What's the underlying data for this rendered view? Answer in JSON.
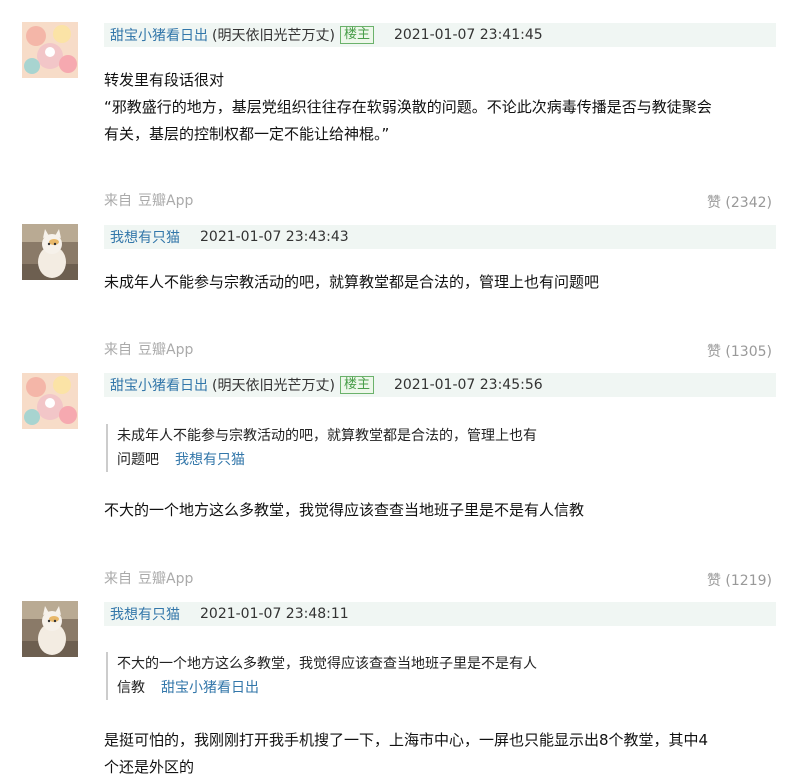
{
  "comments": [
    {
      "username": "甜宝小猪看日出",
      "signature": "(明天依旧光芒万丈)",
      "badge": "楼主",
      "time": "2021-01-07 23:41:45",
      "text_lines": [
        "转发里有段话很对",
        "“邪教盛行的地方，基层党组织往往存在软弱涣散的问题。不论此次病毒传播是否与教徒聚会",
        "有关，基层的控制权都一定不能让给神棍。”"
      ],
      "from_label": "来自",
      "from_app": "豆瓣App",
      "like": "赞 (2342)"
    },
    {
      "username": "我想有只猫",
      "time": "2021-01-07 23:43:43",
      "text_lines": [
        "未成年人不能参与宗教活动的吧，就算教堂都是合法的，管理上也有问题吧"
      ],
      "from_label": "来自",
      "from_app": "豆瓣App",
      "like": "赞 (1305)"
    },
    {
      "username": "甜宝小猪看日出",
      "signature": "(明天依旧光芒万丈)",
      "badge": "楼主",
      "time": "2021-01-07 23:45:56",
      "quote_lines": [
        "未成年人不能参与宗教活动的吧，就算教堂都是合法的，管理上也有",
        "问题吧"
      ],
      "quote_author": "我想有只猫",
      "text_lines": [
        "不大的一个地方这么多教堂，我觉得应该查查当地班子里是不是有人信教"
      ],
      "from_label": "来自",
      "from_app": "豆瓣App",
      "like": "赞 (1219)"
    },
    {
      "username": "我想有只猫",
      "time": "2021-01-07 23:48:11",
      "quote_lines": [
        "不大的一个地方这么多教堂，我觉得应该查查当地班子里是不是有人",
        "信教"
      ],
      "quote_author": "甜宝小猪看日出",
      "text_lines": [
        "是挺可怕的，我刚刚打开我手机搜了一下，上海市中心，一屏也只能显示出8个教堂，其中4",
        "个还是外区的"
      ]
    }
  ]
}
